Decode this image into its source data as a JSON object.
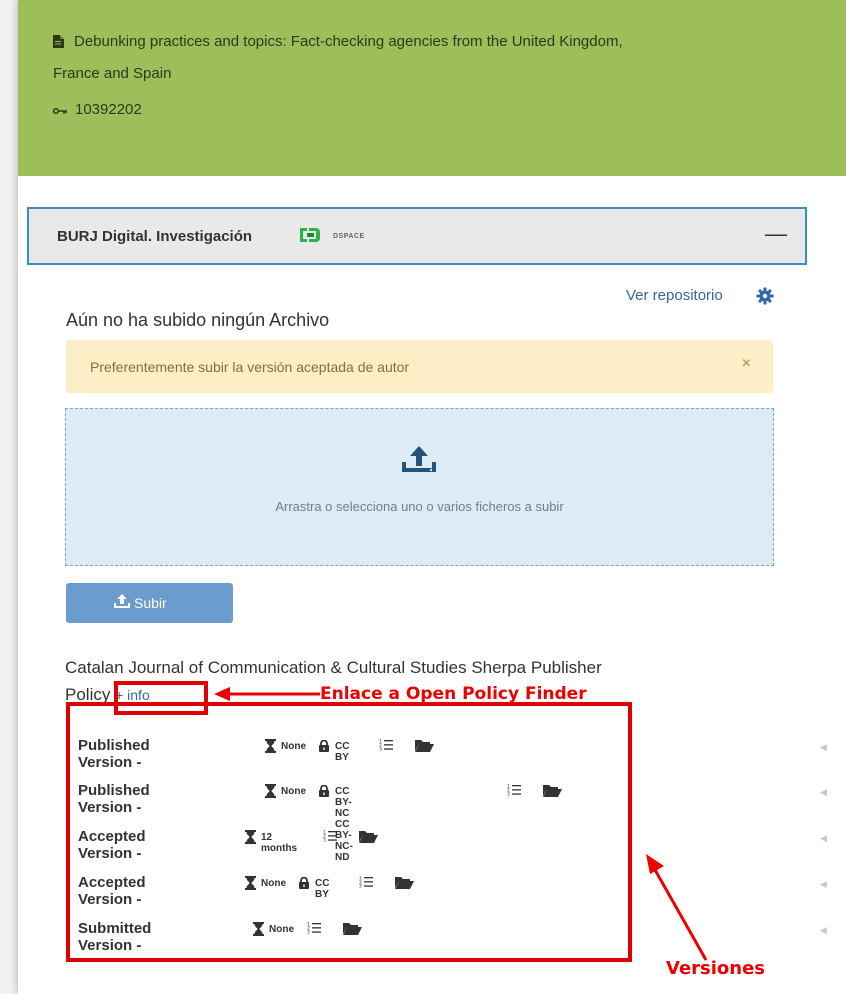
{
  "header": {
    "title_line1": "Debunking practices and topics: Fact-checking agencies from the United Kingdom,",
    "title_line2": "France and Spain",
    "id": "10392202"
  },
  "repository": {
    "name": "BURJ Digital. Investigación",
    "logo_text": "DSPACE",
    "collapse_symbol": "—",
    "view_link": "Ver repositorio"
  },
  "upload": {
    "heading": "Aún no ha subido ningún Archivo",
    "alert_text": "Preferentemente subir la versión aceptada de autor",
    "alert_close": "×",
    "dropzone_text": "Arrastra o selecciona uno o varios ficheros a subir",
    "submit_label": "Subir"
  },
  "policy": {
    "line1": "Catalan Journal of Communication & Cultural Studies Sherpa Publisher",
    "line2_prefix": "Policy",
    "info_link": "+ info"
  },
  "annotations": {
    "link_label": "Enlace a Open Policy Finder",
    "versions_label": "Versiones"
  },
  "versions": [
    {
      "name": "Published Version -",
      "embargo": "None",
      "license": "CC BY"
    },
    {
      "name": "Published Version -",
      "embargo": "None",
      "license": "CC BY-NC CC BY-NC-ND"
    },
    {
      "name": "Accepted Version -",
      "embargo": "12 months",
      "license": ""
    },
    {
      "name": "Accepted Version -",
      "embargo": "None",
      "license": "CC BY"
    },
    {
      "name": "Submitted Version -",
      "embargo": "None",
      "license": ""
    }
  ],
  "colors": {
    "header_bg": "#9dbf5b",
    "accent_blue": "#3267a8",
    "annotation_red": "#ee0000",
    "alert_bg": "#fcefc7",
    "dropzone_bg": "#dcebf6"
  }
}
